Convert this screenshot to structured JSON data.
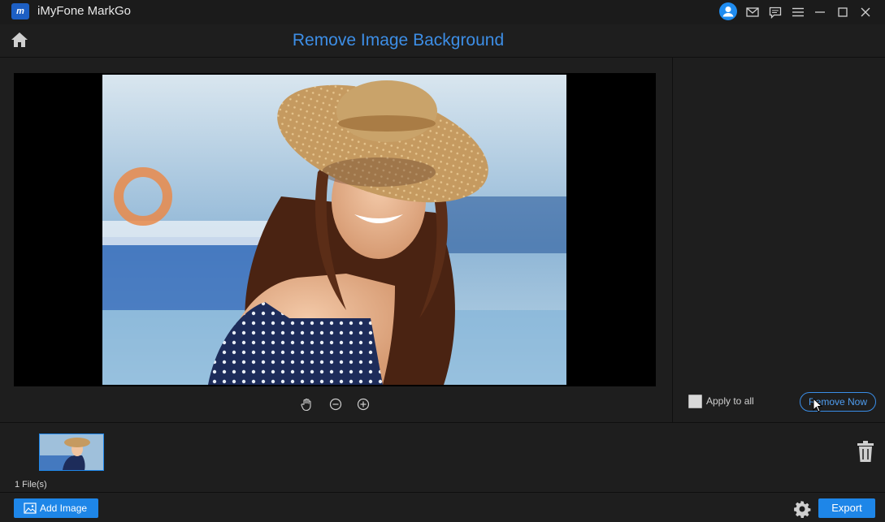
{
  "app": {
    "title": "iMyFone MarkGo",
    "logo_text": "m"
  },
  "window_controls": [
    "account-icon",
    "mail-icon",
    "feedback-icon",
    "menu-icon",
    "minimize-icon",
    "maximize-icon",
    "close-icon"
  ],
  "header": {
    "title": "Remove Image Background"
  },
  "canvas_tools": [
    "hand-icon",
    "zoom-out-icon",
    "zoom-in-icon"
  ],
  "side_panel": {
    "apply_all_label": "Apply to all",
    "apply_all_checked": false,
    "remove_now_label": "Remove Now"
  },
  "files": {
    "count_label": "1 File(s)"
  },
  "footer": {
    "add_image_label": "Add Image",
    "export_label": "Export"
  },
  "colors": {
    "accent": "#1e86e8",
    "title_blue": "#3d8ee6",
    "background": "#1e1e1e"
  }
}
